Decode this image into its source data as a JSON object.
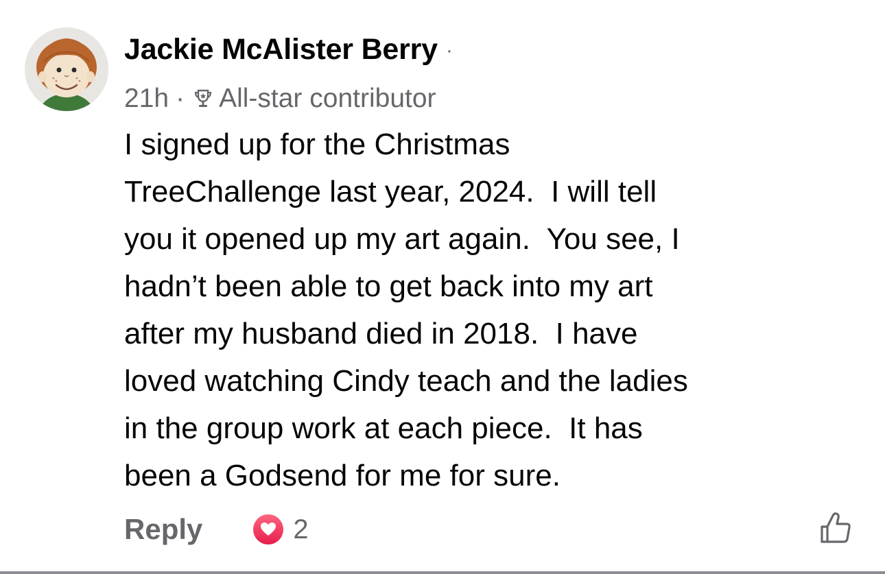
{
  "comment": {
    "author": "Jackie McAlister Berry",
    "author_separator": "·",
    "time": "21h",
    "meta_separator": "·",
    "badge_icon": "trophy-icon",
    "badge_label": "All-star contributor",
    "body_lines": [
      "I signed up for the Christmas",
      "TreeChallenge last year, 2024.  I will tell",
      "you it opened up my art again.  You see, I",
      "hadn’t been able to get back into my art",
      "after my husband died in 2018.  I have",
      "loved watching Cindy teach and the ladies",
      "in the group work at each piece.  It has",
      "been a Godsend for me for sure."
    ],
    "actions": {
      "reply_label": "Reply",
      "reaction_icon": "heart-icon",
      "reaction_count": "2",
      "like_icon": "thumbs-up-icon"
    }
  },
  "colors": {
    "text_primary": "#050505",
    "text_secondary": "#65676b",
    "heart": "#e61e4d"
  }
}
